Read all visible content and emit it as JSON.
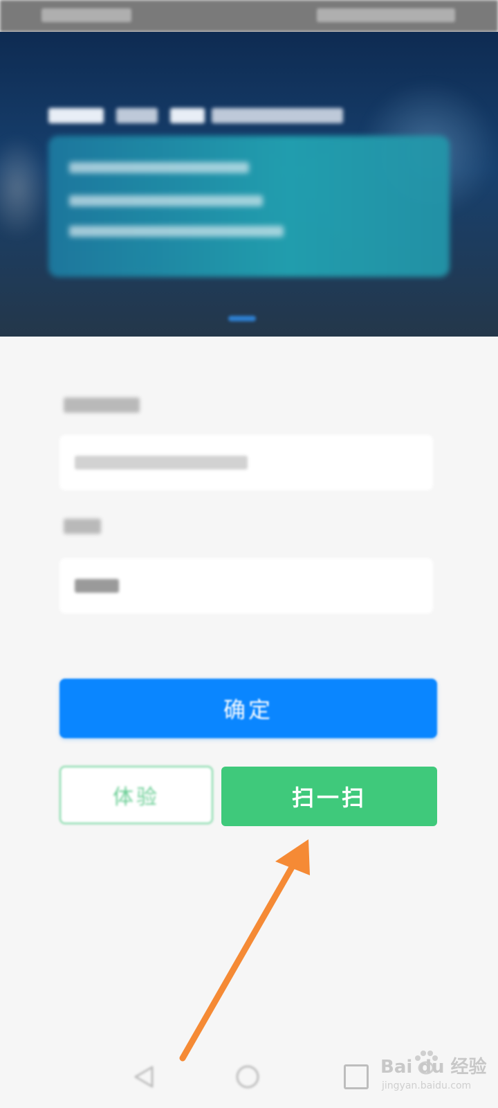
{
  "buttons": {
    "confirm_label": "确定",
    "trial_label": "体验",
    "scan_label": "扫一扫"
  },
  "navigation": {
    "items": [
      "back-icon",
      "home-icon",
      "recent-apps-icon"
    ]
  },
  "watermark": {
    "main": "Bai du 经验",
    "sub": "jingyan.baidu.com"
  },
  "colors": {
    "confirm": "#0a86ff",
    "scan": "#3fc97b",
    "trial_border": "#6fd49b",
    "annotation_arrow": "#f58a35",
    "banner": "#17406e"
  }
}
